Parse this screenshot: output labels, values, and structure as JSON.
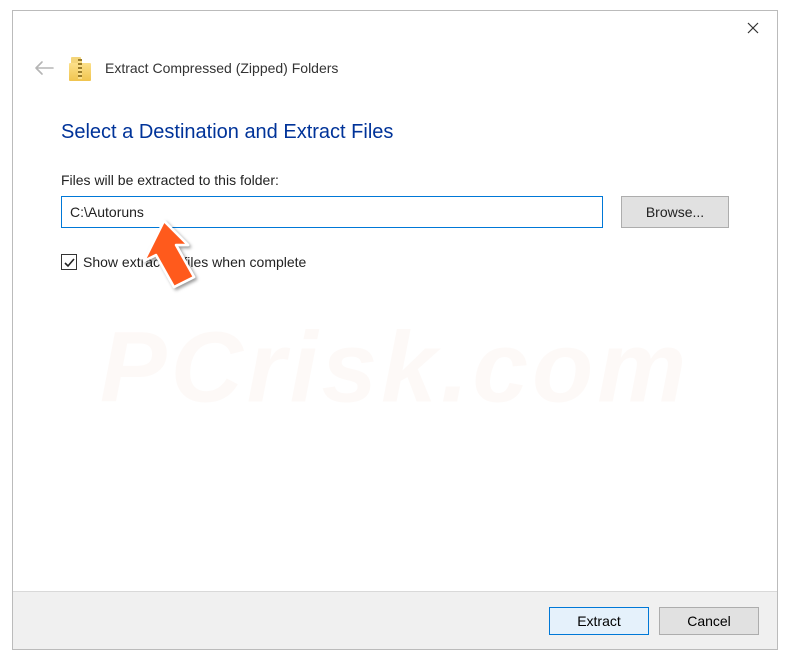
{
  "window": {
    "title": "Extract Compressed (Zipped) Folders"
  },
  "content": {
    "heading": "Select a Destination and Extract Files",
    "label": "Files will be extracted to this folder:",
    "path_value": "C:\\Autoruns",
    "browse_label": "Browse...",
    "checkbox_label": "Show extracted files when complete",
    "checkbox_checked": true
  },
  "footer": {
    "extract_label": "Extract",
    "cancel_label": "Cancel"
  },
  "watermark": "PCrisk.com"
}
